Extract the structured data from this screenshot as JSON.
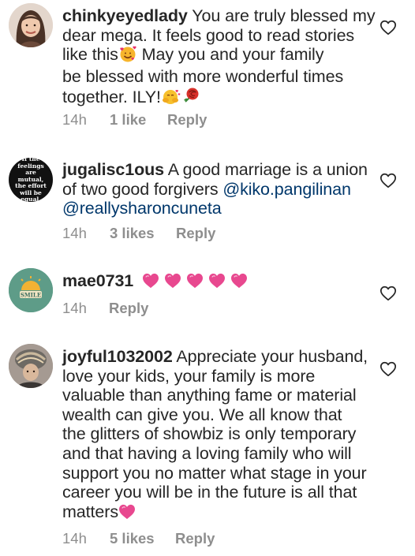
{
  "comments": [
    {
      "username": "chinkyeyedlady",
      "lines": [
        " You are truly blessed my",
        "dear mega. It feels good to read stories",
        "like this",
        " May you and your family",
        "be blessed with more wonderful times",
        "together. ILY!"
      ],
      "time": "14h",
      "likes": "1 like",
      "reply": "Reply",
      "avatar_icon": "girl-portrait"
    },
    {
      "username": "jugalisc1ous",
      "text": " A good marriage is a union",
      "line2_prefix": "of two good forgivers ",
      "mention1": "@kiko.pangilinan",
      "mention2": "@reallysharoncuneta",
      "time": "14h",
      "likes": "3 likes",
      "reply": "Reply",
      "avatar_text": "If the feelings are mutual, the effort will be equal."
    },
    {
      "username": "mae0731",
      "time": "14h",
      "reply": "Reply",
      "avatar_text": "SMILE"
    },
    {
      "username": "joyful1032002",
      "lines": [
        " Appreciate your husband,",
        "love your kids, your family is more",
        "valuable than anything fame or material",
        "wealth can give you. We all know that",
        "the glitters of showbiz is only temporary",
        "and that having a loving family who will",
        "support you no matter what stage in your",
        "career you will be in the future is all that",
        "matters"
      ],
      "time": "14h",
      "likes": "5 likes",
      "reply": "Reply",
      "avatar_icon": "turban-portrait"
    }
  ],
  "colors": {
    "heart": "#e8488f",
    "meta": "#8e8e8e",
    "text": "#262626",
    "mention": "#00376b"
  }
}
